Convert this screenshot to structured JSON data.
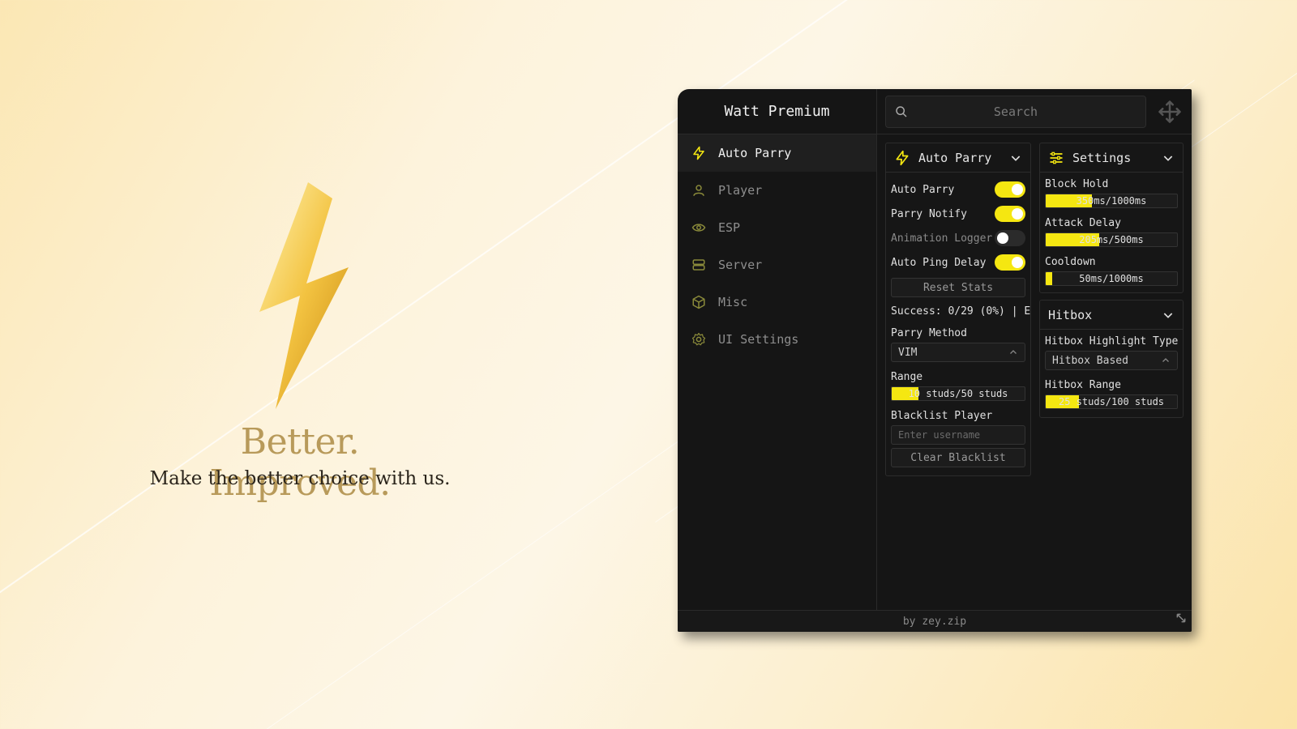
{
  "brand": {
    "headline": "Better. Improved.",
    "subline": "Make the better choice with us."
  },
  "window": {
    "title": "Watt Premium",
    "search_placeholder": "Search",
    "footer": "by zey.zip",
    "accent": "#f5e711"
  },
  "sidebar": {
    "items": [
      {
        "label": "Auto Parry",
        "icon": "lightning-icon",
        "active": true
      },
      {
        "label": "Player",
        "icon": "user-icon",
        "active": false
      },
      {
        "label": "ESP",
        "icon": "eye-icon",
        "active": false
      },
      {
        "label": "Server",
        "icon": "server-icon",
        "active": false
      },
      {
        "label": "Misc",
        "icon": "cube-icon",
        "active": false
      },
      {
        "label": "UI Settings",
        "icon": "gear-icon",
        "active": false
      }
    ]
  },
  "auto_parry": {
    "title": "Auto Parry",
    "toggles": [
      {
        "label": "Auto Parry",
        "on": true
      },
      {
        "label": "Parry Notify",
        "on": true
      },
      {
        "label": "Animation Logger",
        "on": false
      },
      {
        "label": "Auto Ping Delay",
        "on": true
      }
    ],
    "reset_label": "Reset Stats",
    "success_text": "Success: 0/29 (0%) | E",
    "parry_method_label": "Parry Method",
    "parry_method_value": "VIM",
    "range_label": "Range",
    "range_text": "10 studs/50 studs",
    "range_fraction": 0.2,
    "blacklist_label": "Blacklist Player",
    "blacklist_placeholder": "Enter username",
    "clear_label": "Clear Blacklist"
  },
  "settings": {
    "title": "Settings",
    "block_hold_label": "Block Hold",
    "block_hold_text": "350ms/1000ms",
    "block_hold_fraction": 0.35,
    "attack_delay_label": "Attack Delay",
    "attack_delay_text": "205ms/500ms",
    "attack_delay_fraction": 0.41,
    "cooldown_label": "Cooldown",
    "cooldown_text": "50ms/1000ms",
    "cooldown_fraction": 0.05
  },
  "hitbox": {
    "title": "Hitbox",
    "highlight_label": "Hitbox Highlight Type",
    "highlight_value": "Hitbox Based",
    "range_label": "Hitbox Range",
    "range_text": "25 studs/100 studs",
    "range_fraction": 0.25
  }
}
